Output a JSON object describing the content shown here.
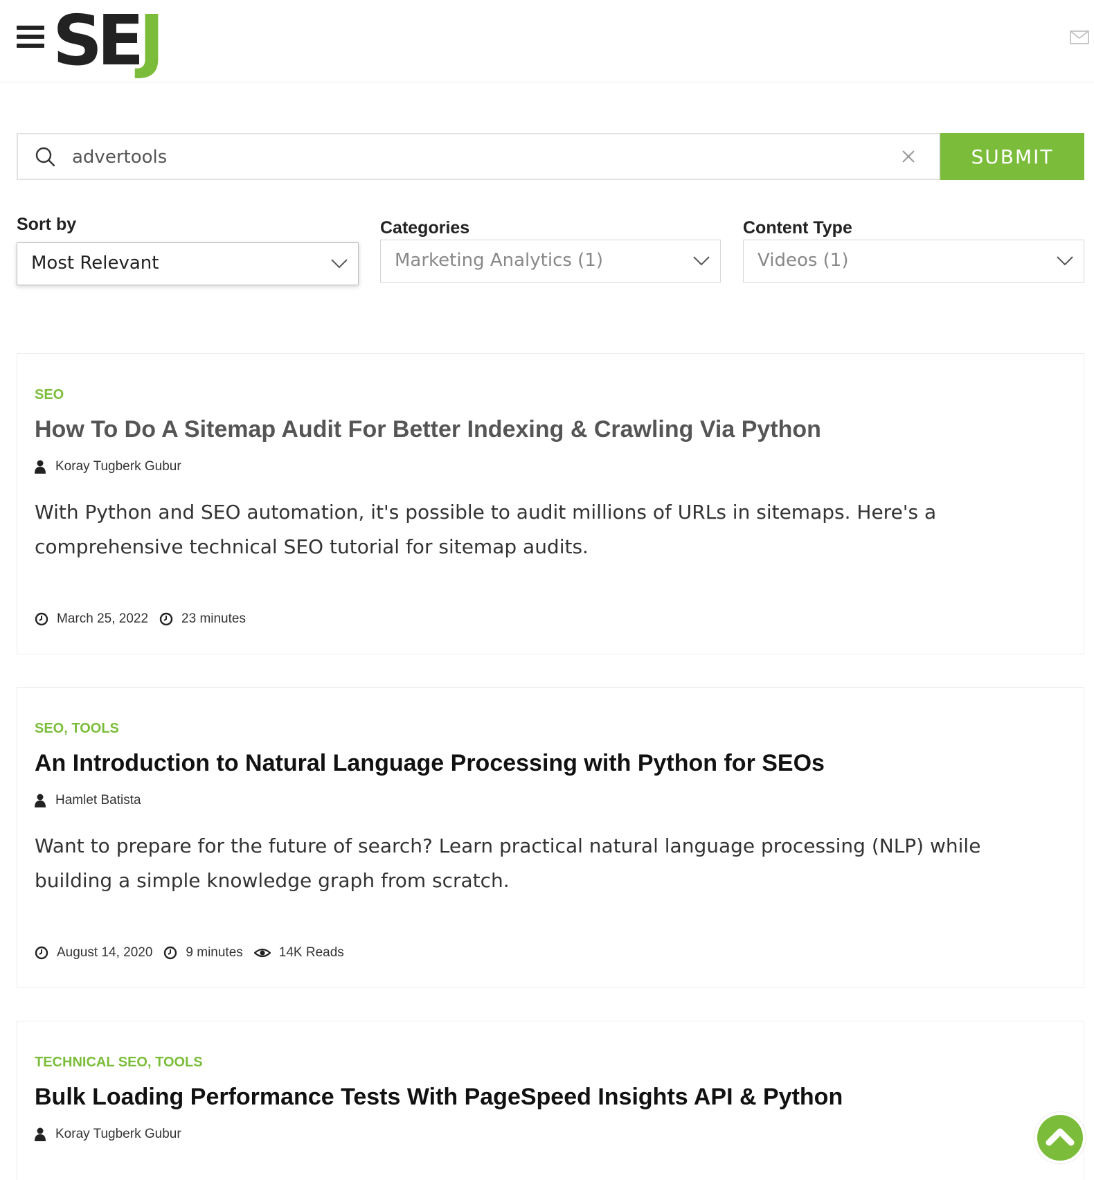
{
  "header": {
    "logo_se": "SE",
    "logo_j": "J",
    "menu_icon": "hamburger-icon",
    "mail_icon": "mail-icon"
  },
  "search": {
    "value": "advertools",
    "submit_label": "SUBMIT",
    "search_icon": "search-icon",
    "clear_icon": "close-icon"
  },
  "filters": {
    "sort_label": "Sort by",
    "sort_value": "Most Relevant",
    "categories_label": "Categories",
    "categories_value": "Marketing Analytics (1)",
    "content_type_label": "Content Type",
    "content_type_value": "Videos (1)"
  },
  "results": [
    {
      "categories": "SEO",
      "title": "How To Do A Sitemap Audit For Better Indexing & Crawling Via Python",
      "author": "Koray Tugberk Gubur",
      "excerpt": "With Python and SEO automation, it's possible to audit millions of URLs in sitemaps. Here's a comprehensive technical SEO tutorial for sitemap audits.",
      "date": "March 25, 2022",
      "read_time": "23 minutes"
    },
    {
      "categories": "SEO, TOOLS",
      "title": "An Introduction to Natural Language Processing with Python for SEOs",
      "author": "Hamlet Batista",
      "excerpt": "Want to prepare for the future of search? Learn practical natural language processing (NLP) while building a simple knowledge graph from scratch.",
      "date": "August 14, 2020",
      "read_time": "9 minutes",
      "reads": "14K Reads"
    },
    {
      "categories": "TECHNICAL SEO, TOOLS",
      "title": "Bulk Loading Performance Tests With PageSpeed Insights API & Python",
      "author": "Koray Tugberk Gubur"
    }
  ],
  "colors": {
    "brand_green": "#7bbd3a",
    "text_dark": "#222222"
  }
}
